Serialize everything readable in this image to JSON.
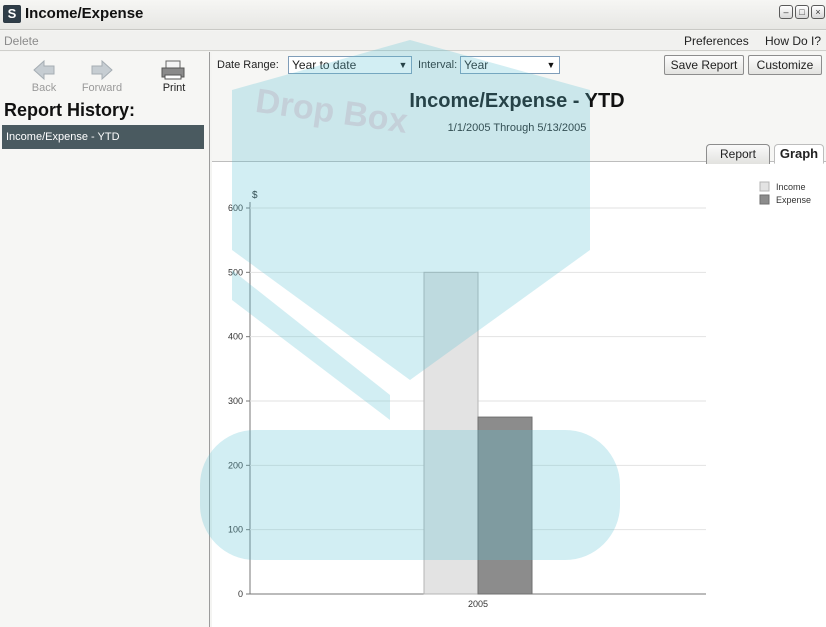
{
  "window": {
    "title": "Income/Expense",
    "app_icon": "S"
  },
  "menubar": {
    "delete": "Delete",
    "preferences": "Preferences",
    "how_do_i": "How Do I?"
  },
  "nav": {
    "back": "Back",
    "forward": "Forward",
    "print": "Print"
  },
  "history": {
    "title": "Report History:",
    "items": [
      "Income/Expense - YTD"
    ]
  },
  "toolbar": {
    "date_range_label": "Date Range:",
    "date_range_value": "Year to date",
    "interval_label": "Interval:",
    "interval_value": "Year",
    "save_report": "Save Report",
    "customize": "Customize"
  },
  "report": {
    "title": "Income/Expense - YTD",
    "dates": "1/1/2005 Through 5/13/2005"
  },
  "tabs": {
    "report": "Report",
    "graph": "Graph"
  },
  "watermark": "Drop Box",
  "colors": {
    "income": "#e3e3e3",
    "expense": "#8c8c8c",
    "selection": "#4a5a60",
    "watermark": "#5fc3d5"
  },
  "chart_data": {
    "type": "bar",
    "categories": [
      "2005"
    ],
    "series": [
      {
        "name": "Income",
        "values": [
          500
        ]
      },
      {
        "name": "Expense",
        "values": [
          275
        ]
      }
    ],
    "ylabel": "$",
    "ylim": [
      0,
      600
    ],
    "yticks": [
      0,
      100,
      200,
      300,
      400,
      500,
      600
    ],
    "grid": true,
    "legend": "top-right"
  }
}
